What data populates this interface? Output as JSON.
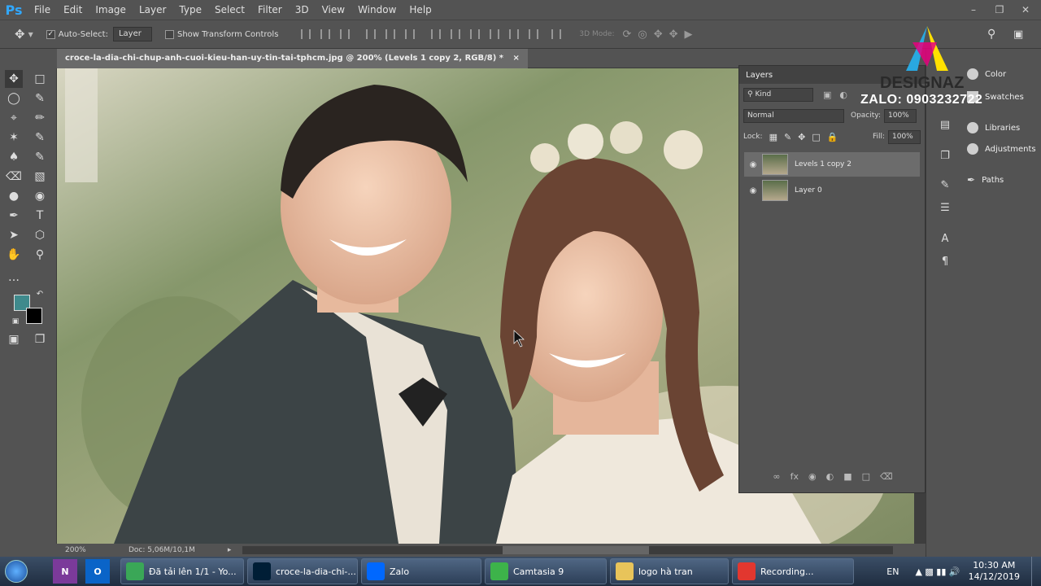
{
  "app": {
    "logo": "Ps"
  },
  "menu": [
    "File",
    "Edit",
    "Image",
    "Layer",
    "Type",
    "Select",
    "Filter",
    "3D",
    "View",
    "Window",
    "Help"
  ],
  "options": {
    "auto_select_label": "Auto-Select:",
    "auto_select_value": "Layer",
    "transform_label": "Show Transform Controls",
    "mode_3d": "3D Mode:"
  },
  "document": {
    "tab_title": "croce-la-dia-chi-chup-anh-cuoi-kieu-han-uy-tin-tai-tphcm.jpg @ 200% (Levels 1 copy 2, RGB/8) *",
    "close": "×"
  },
  "status": {
    "zoom": "200%",
    "doc": "Doc: 5,06M/10,1M"
  },
  "colors": {
    "foreground": "#3f8a8c",
    "background": "#000000"
  },
  "layers": {
    "title": "Layers",
    "kind": "Kind",
    "blend": "Normal",
    "opacity_label": "Opacity:",
    "opacity": "100%",
    "lock_label": "Lock:",
    "fill_label": "Fill:",
    "fill": "100%",
    "items": [
      {
        "name": "Levels 1 copy 2",
        "selected": true
      },
      {
        "name": "Layer 0",
        "selected": false
      }
    ]
  },
  "dock": {
    "color": "Color",
    "swatches": "Swatches",
    "libraries": "Libraries",
    "adjustments": "Adjustments",
    "paths": "Paths"
  },
  "watermark": {
    "brand": "DESIGNAZ",
    "zalo": "ZALO: 0903232722"
  },
  "taskbar": {
    "items": [
      {
        "label": "Đã tải lên 1/1 - Yo...",
        "icon": "chrome-icon",
        "color": "#3aa757"
      },
      {
        "label": "croce-la-dia-chi-...",
        "icon": "photoshop-icon",
        "color": "#001e36"
      },
      {
        "label": "Zalo",
        "icon": "zalo-icon",
        "color": "#0068ff"
      },
      {
        "label": "Camtasia 9",
        "icon": "camtasia-icon",
        "color": "#3db34a"
      },
      {
        "label": "logo hà tran",
        "icon": "folder-icon",
        "color": "#e8c45a"
      },
      {
        "label": "Recording...",
        "icon": "camtasia-recorder-icon",
        "color": "#e2372f"
      }
    ],
    "lang": "EN",
    "time": "10:30 AM",
    "date": "14/12/2019"
  }
}
